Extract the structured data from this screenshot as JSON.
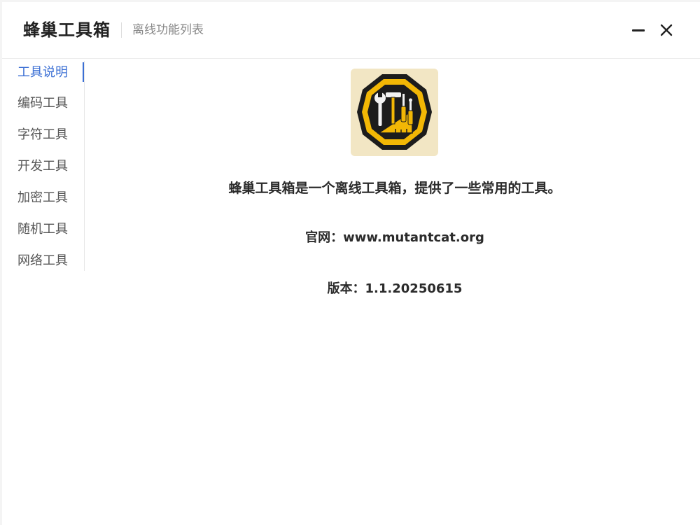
{
  "titlebar": {
    "app_title": "蜂巢工具箱",
    "subtitle": "离线功能列表"
  },
  "sidebar": {
    "items": [
      {
        "label": "工具说明",
        "active": true
      },
      {
        "label": "编码工具",
        "active": false
      },
      {
        "label": "字符工具",
        "active": false
      },
      {
        "label": "开发工具",
        "active": false
      },
      {
        "label": "加密工具",
        "active": false
      },
      {
        "label": "随机工具",
        "active": false
      },
      {
        "label": "网络工具",
        "active": false
      }
    ]
  },
  "main": {
    "logo_icon": "toolbox-badge-icon",
    "description": "蜂巢工具箱是一个离线工具箱，提供了一些常用的工具。",
    "website": "官网：www.mutantcat.org",
    "version": "版本：1.1.20250615"
  },
  "colors": {
    "accent": "#3b6fd4",
    "logo_bg": "#f2e6c4",
    "logo_gold": "#f2b705",
    "logo_dark": "#1c1c1c"
  }
}
